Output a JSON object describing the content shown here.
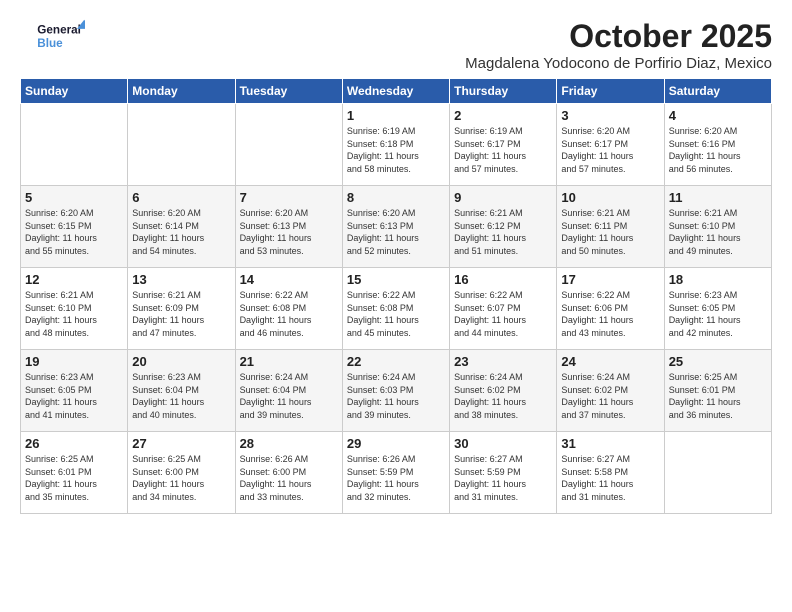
{
  "header": {
    "logo_line1": "General",
    "logo_line2": "Blue",
    "month": "October 2025",
    "location": "Magdalena Yodocono de Porfirio Diaz, Mexico"
  },
  "weekdays": [
    "Sunday",
    "Monday",
    "Tuesday",
    "Wednesday",
    "Thursday",
    "Friday",
    "Saturday"
  ],
  "weeks": [
    [
      {
        "day": "",
        "info": ""
      },
      {
        "day": "",
        "info": ""
      },
      {
        "day": "",
        "info": ""
      },
      {
        "day": "1",
        "info": "Sunrise: 6:19 AM\nSunset: 6:18 PM\nDaylight: 11 hours\nand 58 minutes."
      },
      {
        "day": "2",
        "info": "Sunrise: 6:19 AM\nSunset: 6:17 PM\nDaylight: 11 hours\nand 57 minutes."
      },
      {
        "day": "3",
        "info": "Sunrise: 6:20 AM\nSunset: 6:17 PM\nDaylight: 11 hours\nand 57 minutes."
      },
      {
        "day": "4",
        "info": "Sunrise: 6:20 AM\nSunset: 6:16 PM\nDaylight: 11 hours\nand 56 minutes."
      }
    ],
    [
      {
        "day": "5",
        "info": "Sunrise: 6:20 AM\nSunset: 6:15 PM\nDaylight: 11 hours\nand 55 minutes."
      },
      {
        "day": "6",
        "info": "Sunrise: 6:20 AM\nSunset: 6:14 PM\nDaylight: 11 hours\nand 54 minutes."
      },
      {
        "day": "7",
        "info": "Sunrise: 6:20 AM\nSunset: 6:13 PM\nDaylight: 11 hours\nand 53 minutes."
      },
      {
        "day": "8",
        "info": "Sunrise: 6:20 AM\nSunset: 6:13 PM\nDaylight: 11 hours\nand 52 minutes."
      },
      {
        "day": "9",
        "info": "Sunrise: 6:21 AM\nSunset: 6:12 PM\nDaylight: 11 hours\nand 51 minutes."
      },
      {
        "day": "10",
        "info": "Sunrise: 6:21 AM\nSunset: 6:11 PM\nDaylight: 11 hours\nand 50 minutes."
      },
      {
        "day": "11",
        "info": "Sunrise: 6:21 AM\nSunset: 6:10 PM\nDaylight: 11 hours\nand 49 minutes."
      }
    ],
    [
      {
        "day": "12",
        "info": "Sunrise: 6:21 AM\nSunset: 6:10 PM\nDaylight: 11 hours\nand 48 minutes."
      },
      {
        "day": "13",
        "info": "Sunrise: 6:21 AM\nSunset: 6:09 PM\nDaylight: 11 hours\nand 47 minutes."
      },
      {
        "day": "14",
        "info": "Sunrise: 6:22 AM\nSunset: 6:08 PM\nDaylight: 11 hours\nand 46 minutes."
      },
      {
        "day": "15",
        "info": "Sunrise: 6:22 AM\nSunset: 6:08 PM\nDaylight: 11 hours\nand 45 minutes."
      },
      {
        "day": "16",
        "info": "Sunrise: 6:22 AM\nSunset: 6:07 PM\nDaylight: 11 hours\nand 44 minutes."
      },
      {
        "day": "17",
        "info": "Sunrise: 6:22 AM\nSunset: 6:06 PM\nDaylight: 11 hours\nand 43 minutes."
      },
      {
        "day": "18",
        "info": "Sunrise: 6:23 AM\nSunset: 6:05 PM\nDaylight: 11 hours\nand 42 minutes."
      }
    ],
    [
      {
        "day": "19",
        "info": "Sunrise: 6:23 AM\nSunset: 6:05 PM\nDaylight: 11 hours\nand 41 minutes."
      },
      {
        "day": "20",
        "info": "Sunrise: 6:23 AM\nSunset: 6:04 PM\nDaylight: 11 hours\nand 40 minutes."
      },
      {
        "day": "21",
        "info": "Sunrise: 6:24 AM\nSunset: 6:04 PM\nDaylight: 11 hours\nand 39 minutes."
      },
      {
        "day": "22",
        "info": "Sunrise: 6:24 AM\nSunset: 6:03 PM\nDaylight: 11 hours\nand 39 minutes."
      },
      {
        "day": "23",
        "info": "Sunrise: 6:24 AM\nSunset: 6:02 PM\nDaylight: 11 hours\nand 38 minutes."
      },
      {
        "day": "24",
        "info": "Sunrise: 6:24 AM\nSunset: 6:02 PM\nDaylight: 11 hours\nand 37 minutes."
      },
      {
        "day": "25",
        "info": "Sunrise: 6:25 AM\nSunset: 6:01 PM\nDaylight: 11 hours\nand 36 minutes."
      }
    ],
    [
      {
        "day": "26",
        "info": "Sunrise: 6:25 AM\nSunset: 6:01 PM\nDaylight: 11 hours\nand 35 minutes."
      },
      {
        "day": "27",
        "info": "Sunrise: 6:25 AM\nSunset: 6:00 PM\nDaylight: 11 hours\nand 34 minutes."
      },
      {
        "day": "28",
        "info": "Sunrise: 6:26 AM\nSunset: 6:00 PM\nDaylight: 11 hours\nand 33 minutes."
      },
      {
        "day": "29",
        "info": "Sunrise: 6:26 AM\nSunset: 5:59 PM\nDaylight: 11 hours\nand 32 minutes."
      },
      {
        "day": "30",
        "info": "Sunrise: 6:27 AM\nSunset: 5:59 PM\nDaylight: 11 hours\nand 31 minutes."
      },
      {
        "day": "31",
        "info": "Sunrise: 6:27 AM\nSunset: 5:58 PM\nDaylight: 11 hours\nand 31 minutes."
      },
      {
        "day": "",
        "info": ""
      }
    ]
  ]
}
